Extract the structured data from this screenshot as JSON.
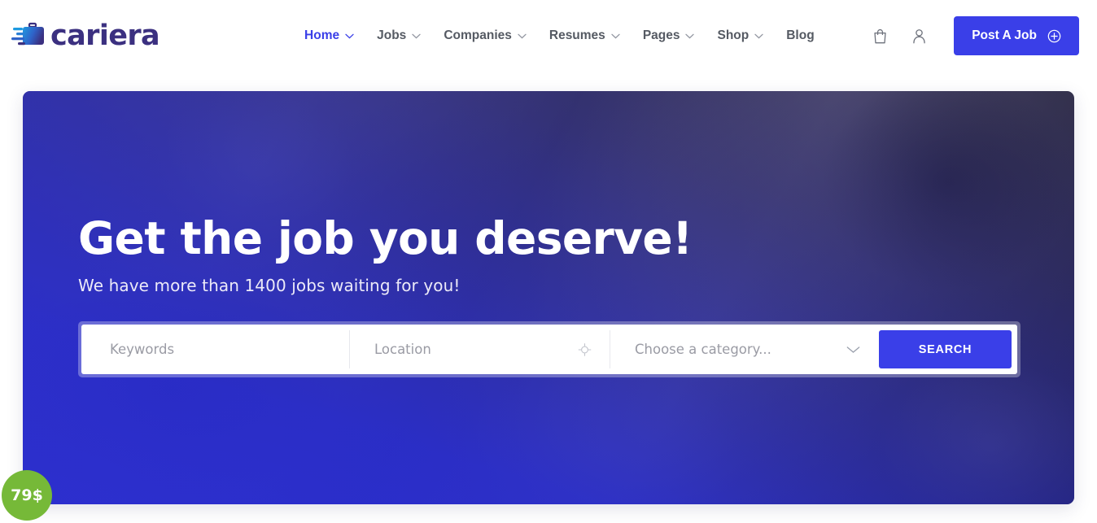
{
  "header": {
    "brand": {
      "word": "cariera",
      "icon": "briefcase-speed-icon"
    },
    "nav": [
      {
        "label": "Home",
        "has_dropdown": true,
        "active": true
      },
      {
        "label": "Jobs",
        "has_dropdown": true,
        "active": false
      },
      {
        "label": "Companies",
        "has_dropdown": true,
        "active": false
      },
      {
        "label": "Resumes",
        "has_dropdown": true,
        "active": false
      },
      {
        "label": "Pages",
        "has_dropdown": true,
        "active": false
      },
      {
        "label": "Shop",
        "has_dropdown": true,
        "active": false
      },
      {
        "label": "Blog",
        "has_dropdown": false,
        "active": false
      }
    ],
    "cart_icon": "shopping-bag-icon",
    "account_icon": "user-account-icon",
    "post_job": {
      "label": "Post A Job",
      "icon": "plus-circle-icon"
    }
  },
  "hero": {
    "title": "Get the job you deserve!",
    "subtitle": "We have more than 1400 jobs waiting for you!",
    "search": {
      "keywords": {
        "placeholder": "Keywords",
        "value": ""
      },
      "location": {
        "placeholder": "Location",
        "value": "",
        "icon": "crosshair-locate-icon"
      },
      "category": {
        "placeholder": "Choose a category...",
        "value": "",
        "icon": "chevron-down-icon"
      },
      "submit_label": "SEARCH"
    },
    "price_badge": "79$"
  },
  "colors": {
    "accent": "#3a3fe8",
    "brand_text": "#3b3080",
    "badge_green": "#76b938",
    "nav_text": "#555a63",
    "placeholder": "#9a9ba4"
  }
}
